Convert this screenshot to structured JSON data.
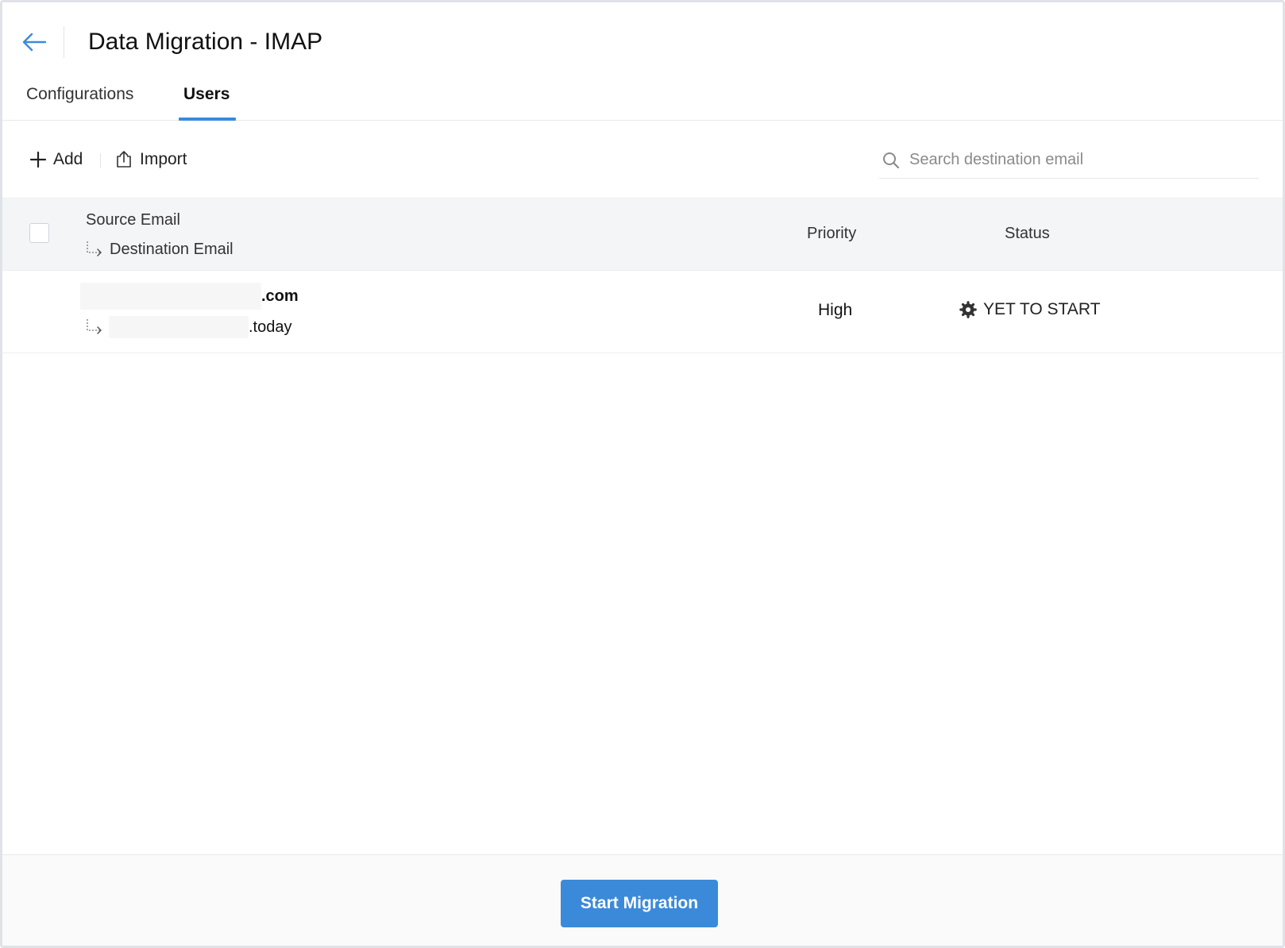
{
  "header": {
    "title": "Data Migration - IMAP",
    "back_icon": "arrow-left-icon"
  },
  "tabs": [
    {
      "label": "Configurations",
      "active": false
    },
    {
      "label": "Users",
      "active": true
    }
  ],
  "toolbar": {
    "add_label": "Add",
    "import_label": "Import",
    "search_placeholder": "Search destination email"
  },
  "table": {
    "columns": {
      "source": "Source Email",
      "destination": "Destination Email",
      "priority": "Priority",
      "status": "Status"
    },
    "rows": [
      {
        "source_email_domain": ".com",
        "destination_email_domain": ".today",
        "priority": "High",
        "status": "YET TO START",
        "status_icon": "gear-icon"
      }
    ]
  },
  "footer": {
    "start_label": "Start Migration"
  },
  "colors": {
    "accent": "#3b8ad9",
    "header_bg": "#f4f5f7",
    "border": "#e6e8eb"
  }
}
